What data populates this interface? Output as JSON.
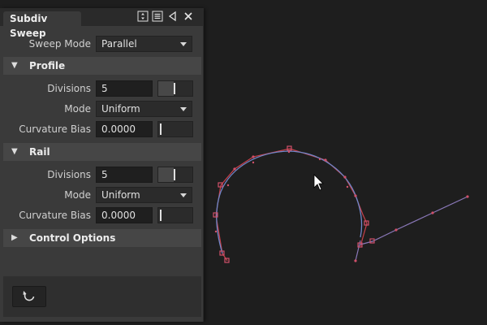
{
  "panel": {
    "title": "Subdiv Sweep",
    "titlebar_icons": [
      "pin-vertical-icon",
      "menu-icon",
      "collapse-left-icon",
      "close-icon"
    ],
    "sweep_mode": {
      "label": "Sweep Mode",
      "value": "Parallel"
    }
  },
  "profile": {
    "title": "Profile",
    "divisions": {
      "label": "Divisions",
      "value": "5",
      "slider_level": 0.45
    },
    "mode": {
      "label": "Mode",
      "value": "Uniform"
    },
    "curvature_bias": {
      "label": "Curvature Bias",
      "value": "0.0000",
      "slider_level": 0.0
    }
  },
  "rail": {
    "title": "Rail",
    "divisions": {
      "label": "Divisions",
      "value": "5",
      "slider_level": 0.45
    },
    "mode": {
      "label": "Mode",
      "value": "Uniform"
    },
    "curvature_bias": {
      "label": "Curvature Bias",
      "value": "0.0000",
      "slider_level": 0.0
    }
  },
  "control_options": {
    "title": "Control Options"
  },
  "footer": {
    "reset_icon": "reset-icon"
  },
  "colors": {
    "viewport_bg": "#1e1e1e",
    "panel_bg": "#3a3a3a",
    "curve_red": "#c8404a",
    "curve_blue": "#6f86c8",
    "point_pink": "#d0506a"
  }
}
